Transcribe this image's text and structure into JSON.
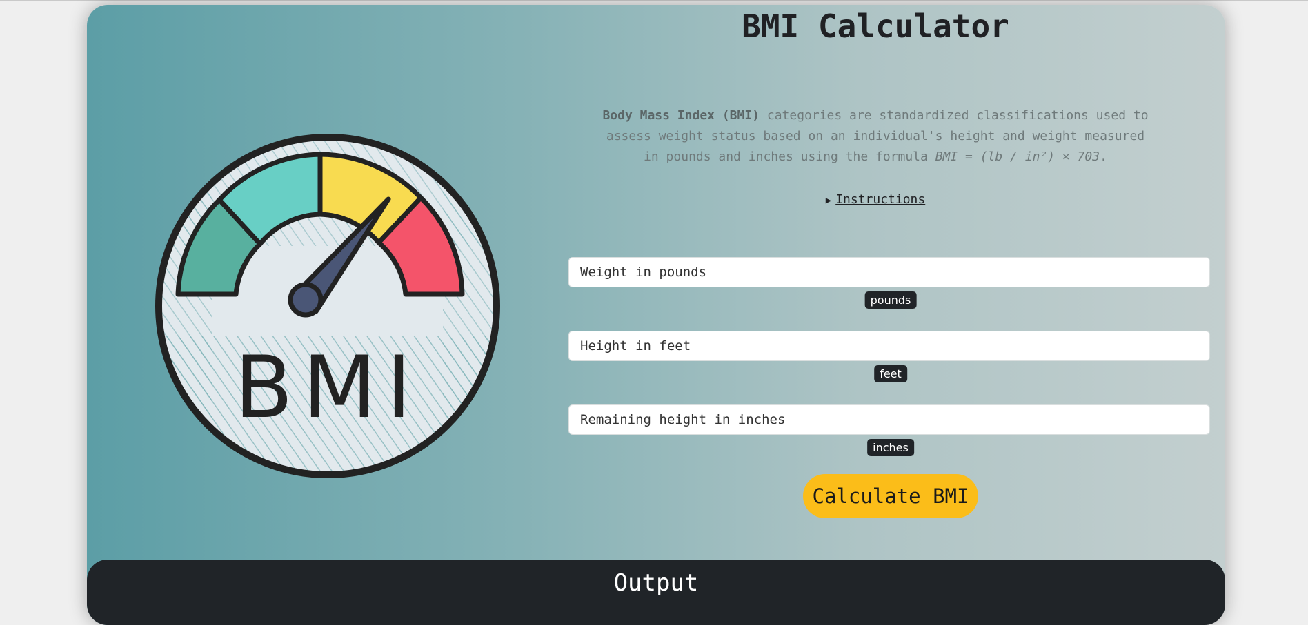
{
  "header": {
    "title": "BMI Calculator"
  },
  "description": {
    "bold_lead": "Body Mass Index (BMI)",
    "text": " categories are standardized classifications used to assess weight status based on an individual's height and weight measured in pounds and inches using the formula ",
    "formula": "BMI = (lb / in²) × 703",
    "end": "."
  },
  "instructions": {
    "label": "Instructions",
    "marker_icon": "triangle-right-icon"
  },
  "form": {
    "weight": {
      "placeholder": "Weight in pounds",
      "value": "",
      "unit": "pounds"
    },
    "feet": {
      "placeholder": "Height in feet",
      "value": "",
      "unit": "feet"
    },
    "inches": {
      "placeholder": "Remaining height in inches",
      "value": "",
      "unit": "inches"
    },
    "submit_label": "Calculate BMI"
  },
  "logo": {
    "text": "BMI"
  },
  "output": {
    "heading": "Output"
  },
  "colors": {
    "accent": "#fbbd19",
    "dark": "#202428",
    "gauge_green": "#58b09f",
    "gauge_teal": "#68cfc5",
    "gauge_yellow": "#f8db50",
    "gauge_red": "#f4546a",
    "needle": "#4a5676"
  }
}
